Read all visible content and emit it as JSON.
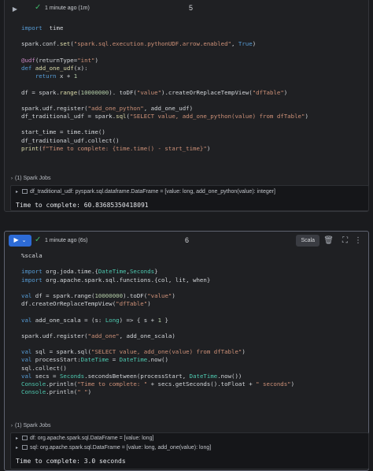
{
  "cell1": {
    "status_time": "1 minute ago (1m)",
    "cell_number": "5",
    "code": [
      [
        [
          "kw",
          "import"
        ],
        [
          "",
          "  time"
        ]
      ],
      [
        [
          "",
          ""
        ]
      ],
      [
        [
          "",
          "spark.conf."
        ],
        [
          "fn",
          "set"
        ],
        [
          "",
          "("
        ],
        [
          "str",
          "\"spark.sql.execution.pythonUDF.arrow.enabled\""
        ],
        [
          "",
          ", "
        ],
        [
          "kw",
          "True"
        ],
        [
          "",
          ")"
        ]
      ],
      [
        [
          "",
          ""
        ]
      ],
      [
        [
          "dec",
          "@udf"
        ],
        [
          "",
          "(returnType="
        ],
        [
          "str",
          "\"int\""
        ],
        [
          "",
          ")"
        ]
      ],
      [
        [
          "kw",
          "def"
        ],
        [
          "fn",
          " add_one_udf"
        ],
        [
          "",
          "(x):"
        ]
      ],
      [
        [
          "",
          "    "
        ],
        [
          "kw",
          "return"
        ],
        [
          "",
          " x + "
        ],
        [
          "num",
          "1"
        ]
      ],
      [
        [
          "",
          ""
        ]
      ],
      [
        [
          "",
          "df = spark."
        ],
        [
          "fn",
          "range"
        ],
        [
          "",
          "("
        ],
        [
          "num",
          "10000000"
        ],
        [
          "",
          "). toDF("
        ],
        [
          "str",
          "\"value\""
        ],
        [
          "",
          ").createOrReplaceTempView("
        ],
        [
          "str",
          "\"dfTable\""
        ],
        [
          "",
          ")"
        ]
      ],
      [
        [
          "",
          ""
        ]
      ],
      [
        [
          "",
          "spark.udf.register("
        ],
        [
          "str",
          "\"add_one_python\""
        ],
        [
          "",
          ", add_one_udf)"
        ]
      ],
      [
        [
          "",
          "df_traditional_udf = spark."
        ],
        [
          "fn",
          "sql"
        ],
        [
          "",
          "("
        ],
        [
          "str",
          "\"SELECT value, add_one_python(value) from dfTable\""
        ],
        [
          "",
          ")"
        ]
      ],
      [
        [
          "",
          ""
        ]
      ],
      [
        [
          "",
          "start_time = time.time()"
        ]
      ],
      [
        [
          "",
          "df_traditional_udf.collect()"
        ]
      ],
      [
        [
          "fn",
          "print"
        ],
        [
          "",
          "("
        ],
        [
          "str",
          "f\"Time to complete: {time.time() - start_time}\""
        ],
        [
          "",
          ")"
        ]
      ]
    ],
    "spark_jobs_label": "(1) Spark Jobs",
    "dataframes": [
      "df_traditional_udf:  pyspark.sql.dataframe.DataFrame = [value: long, add_one_python(value): integer]"
    ],
    "result": "Time to complete: 60.83685350418091"
  },
  "cell2": {
    "status_time": "1 minute ago (6s)",
    "cell_number": "6",
    "language": "Scala",
    "code": [
      [
        [
          "",
          "%scala"
        ]
      ],
      [
        [
          "",
          ""
        ]
      ],
      [
        [
          "kw",
          "import"
        ],
        [
          "",
          " org.joda.time.{"
        ],
        [
          "cls",
          "DateTime"
        ],
        [
          "",
          ","
        ],
        [
          "cls",
          "Seconds"
        ],
        [
          "",
          "}"
        ]
      ],
      [
        [
          "kw",
          "import"
        ],
        [
          "",
          " org.apache.spark.sql.functions.{col, lit, when}"
        ]
      ],
      [
        [
          "",
          ""
        ]
      ],
      [
        [
          "kw",
          "val"
        ],
        [
          "",
          " df = spark.range("
        ],
        [
          "num",
          "10000000"
        ],
        [
          "",
          ").toDF("
        ],
        [
          "str",
          "\"value\""
        ],
        [
          "",
          ")"
        ]
      ],
      [
        [
          "",
          "df.createOrReplaceTempView("
        ],
        [
          "str",
          "\"dfTable\""
        ],
        [
          "",
          ")"
        ]
      ],
      [
        [
          "",
          ""
        ]
      ],
      [
        [
          "kw",
          "val"
        ],
        [
          "",
          " add_one_scala = (s: "
        ],
        [
          "cls",
          "Long"
        ],
        [
          "",
          ") => { s + "
        ],
        [
          "num",
          "1"
        ],
        [
          "",
          " }"
        ]
      ],
      [
        [
          "",
          ""
        ]
      ],
      [
        [
          "",
          "spark.udf.register("
        ],
        [
          "str",
          "\"add_one\""
        ],
        [
          "",
          ", add_one_scala)"
        ]
      ],
      [
        [
          "",
          ""
        ]
      ],
      [
        [
          "kw",
          "val"
        ],
        [
          "",
          " sql = spark.sql("
        ],
        [
          "str",
          "\"SELECT value, add_one(value) from dfTable\""
        ],
        [
          "",
          ")"
        ]
      ],
      [
        [
          "kw",
          "val"
        ],
        [
          "",
          " processStart:"
        ],
        [
          "cls",
          "DateTime"
        ],
        [
          "",
          " = "
        ],
        [
          "cls",
          "DateTime"
        ],
        [
          "",
          ".now()"
        ]
      ],
      [
        [
          "",
          "sql.collect()"
        ]
      ],
      [
        [
          "kw",
          "val"
        ],
        [
          "",
          " secs = "
        ],
        [
          "cls",
          "Seconds"
        ],
        [
          "",
          ".secondsBetween(processStart, "
        ],
        [
          "cls",
          "DateTime"
        ],
        [
          "",
          ".now())"
        ]
      ],
      [
        [
          "cls",
          "Console"
        ],
        [
          "",
          ".println("
        ],
        [
          "str",
          "\"Time to complete: \""
        ],
        [
          "",
          " + secs.getSeconds().toFloat + "
        ],
        [
          "str",
          "\" seconds\""
        ],
        [
          "",
          ")"
        ]
      ],
      [
        [
          "cls",
          "Console"
        ],
        [
          "",
          ".println("
        ],
        [
          "str",
          "\" \""
        ],
        [
          "",
          ")"
        ]
      ]
    ],
    "spark_jobs_label": "(1) Spark Jobs",
    "dataframes": [
      "df:  org.apache.spark.sql.DataFrame = [value: long]",
      "sql:  org.apache.spark.sql.DataFrame = [value: long, add_one(value): long]"
    ],
    "result": "Time to complete: 3.0 seconds"
  },
  "icons": {
    "run": "play-icon",
    "success": "check-icon",
    "delete": "trash-icon",
    "expand": "expand-icon",
    "more": "more-icon",
    "collapse": "caret-right-icon"
  }
}
